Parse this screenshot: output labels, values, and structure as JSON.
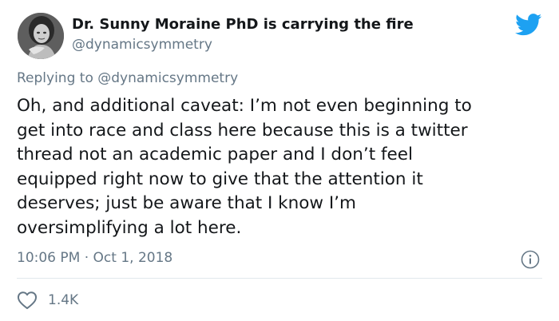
{
  "tweet": {
    "display_name": "Dr. Sunny Moraine PhD is carrying the fire",
    "handle": "@dynamicsymmetry",
    "replying_prefix": "Replying to ",
    "replying_to": "@dynamicsymmetry",
    "text_lines": [
      "Oh, and additional caveat: I’m not even beginning to",
      "get into race and class here because this is a twitter",
      "thread not an academic paper and I don’t feel",
      "equipped right now to give that the attention it",
      "deserves; just be aware that I know I’m",
      "oversimplifying a lot here."
    ],
    "timestamp": "10:06 PM · Oct 1, 2018",
    "like_count": "1.4K"
  },
  "icons": {
    "brand": "twitter-bird-icon",
    "info": "info-icon",
    "like": "heart-icon"
  },
  "colors": {
    "twitter_blue": "#1da1f2",
    "secondary_text": "#657786",
    "primary_text": "#14171a",
    "divider": "#e1e8ed"
  }
}
